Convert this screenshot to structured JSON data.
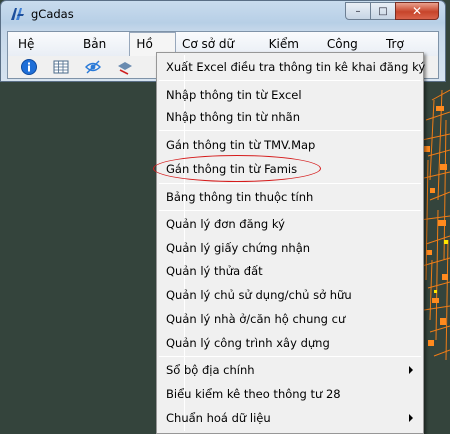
{
  "window": {
    "title": "gCadas",
    "minimize_glyph": "–",
    "maximize_glyph": "□",
    "close_glyph": "✕"
  },
  "menubar": {
    "items": [
      {
        "label": "Hệ thống"
      },
      {
        "label": "Bản đồ"
      },
      {
        "label": "Hồ sơ"
      },
      {
        "label": "Cơ sở dữ liệu"
      },
      {
        "label": "Kiểm kê"
      },
      {
        "label": "Công cụ"
      },
      {
        "label": "Trợ giúp"
      }
    ]
  },
  "toolbar": {
    "icons": [
      "info-icon",
      "table-icon",
      "hide-icon",
      "layers-icon"
    ]
  },
  "dropdown": {
    "items": [
      {
        "label": "Xuất Excel điều tra thông tin kê khai đăng ký"
      },
      {
        "label": "Nhập thông tin từ Excel"
      },
      {
        "label": "Nhập thông tin từ nhãn"
      },
      {
        "label": "Gán thông tin từ TMV.Map"
      },
      {
        "label": "Gán thông tin từ Famis"
      },
      {
        "label": "Bảng thông tin thuộc tính"
      },
      {
        "label": "Quản lý đơn đăng ký"
      },
      {
        "label": "Quản lý giấy chứng nhận"
      },
      {
        "label": "Quản lý thửa đất"
      },
      {
        "label": "Quản lý chủ sử dụng/chủ sở hữu"
      },
      {
        "label": "Quản lý nhà ở/căn hộ chung cư"
      },
      {
        "label": "Quản lý công trình xây dựng"
      },
      {
        "label": "Sổ bộ địa chính"
      },
      {
        "label": "Biểu kiểm kê theo thông tư 28"
      },
      {
        "label": "Chuẩn hoá dữ liệu"
      }
    ],
    "submenu_indicator": "right-arrow-icon"
  },
  "colors": {
    "highlight": "#d51b1b",
    "map_parcels": "#e87a1a"
  }
}
